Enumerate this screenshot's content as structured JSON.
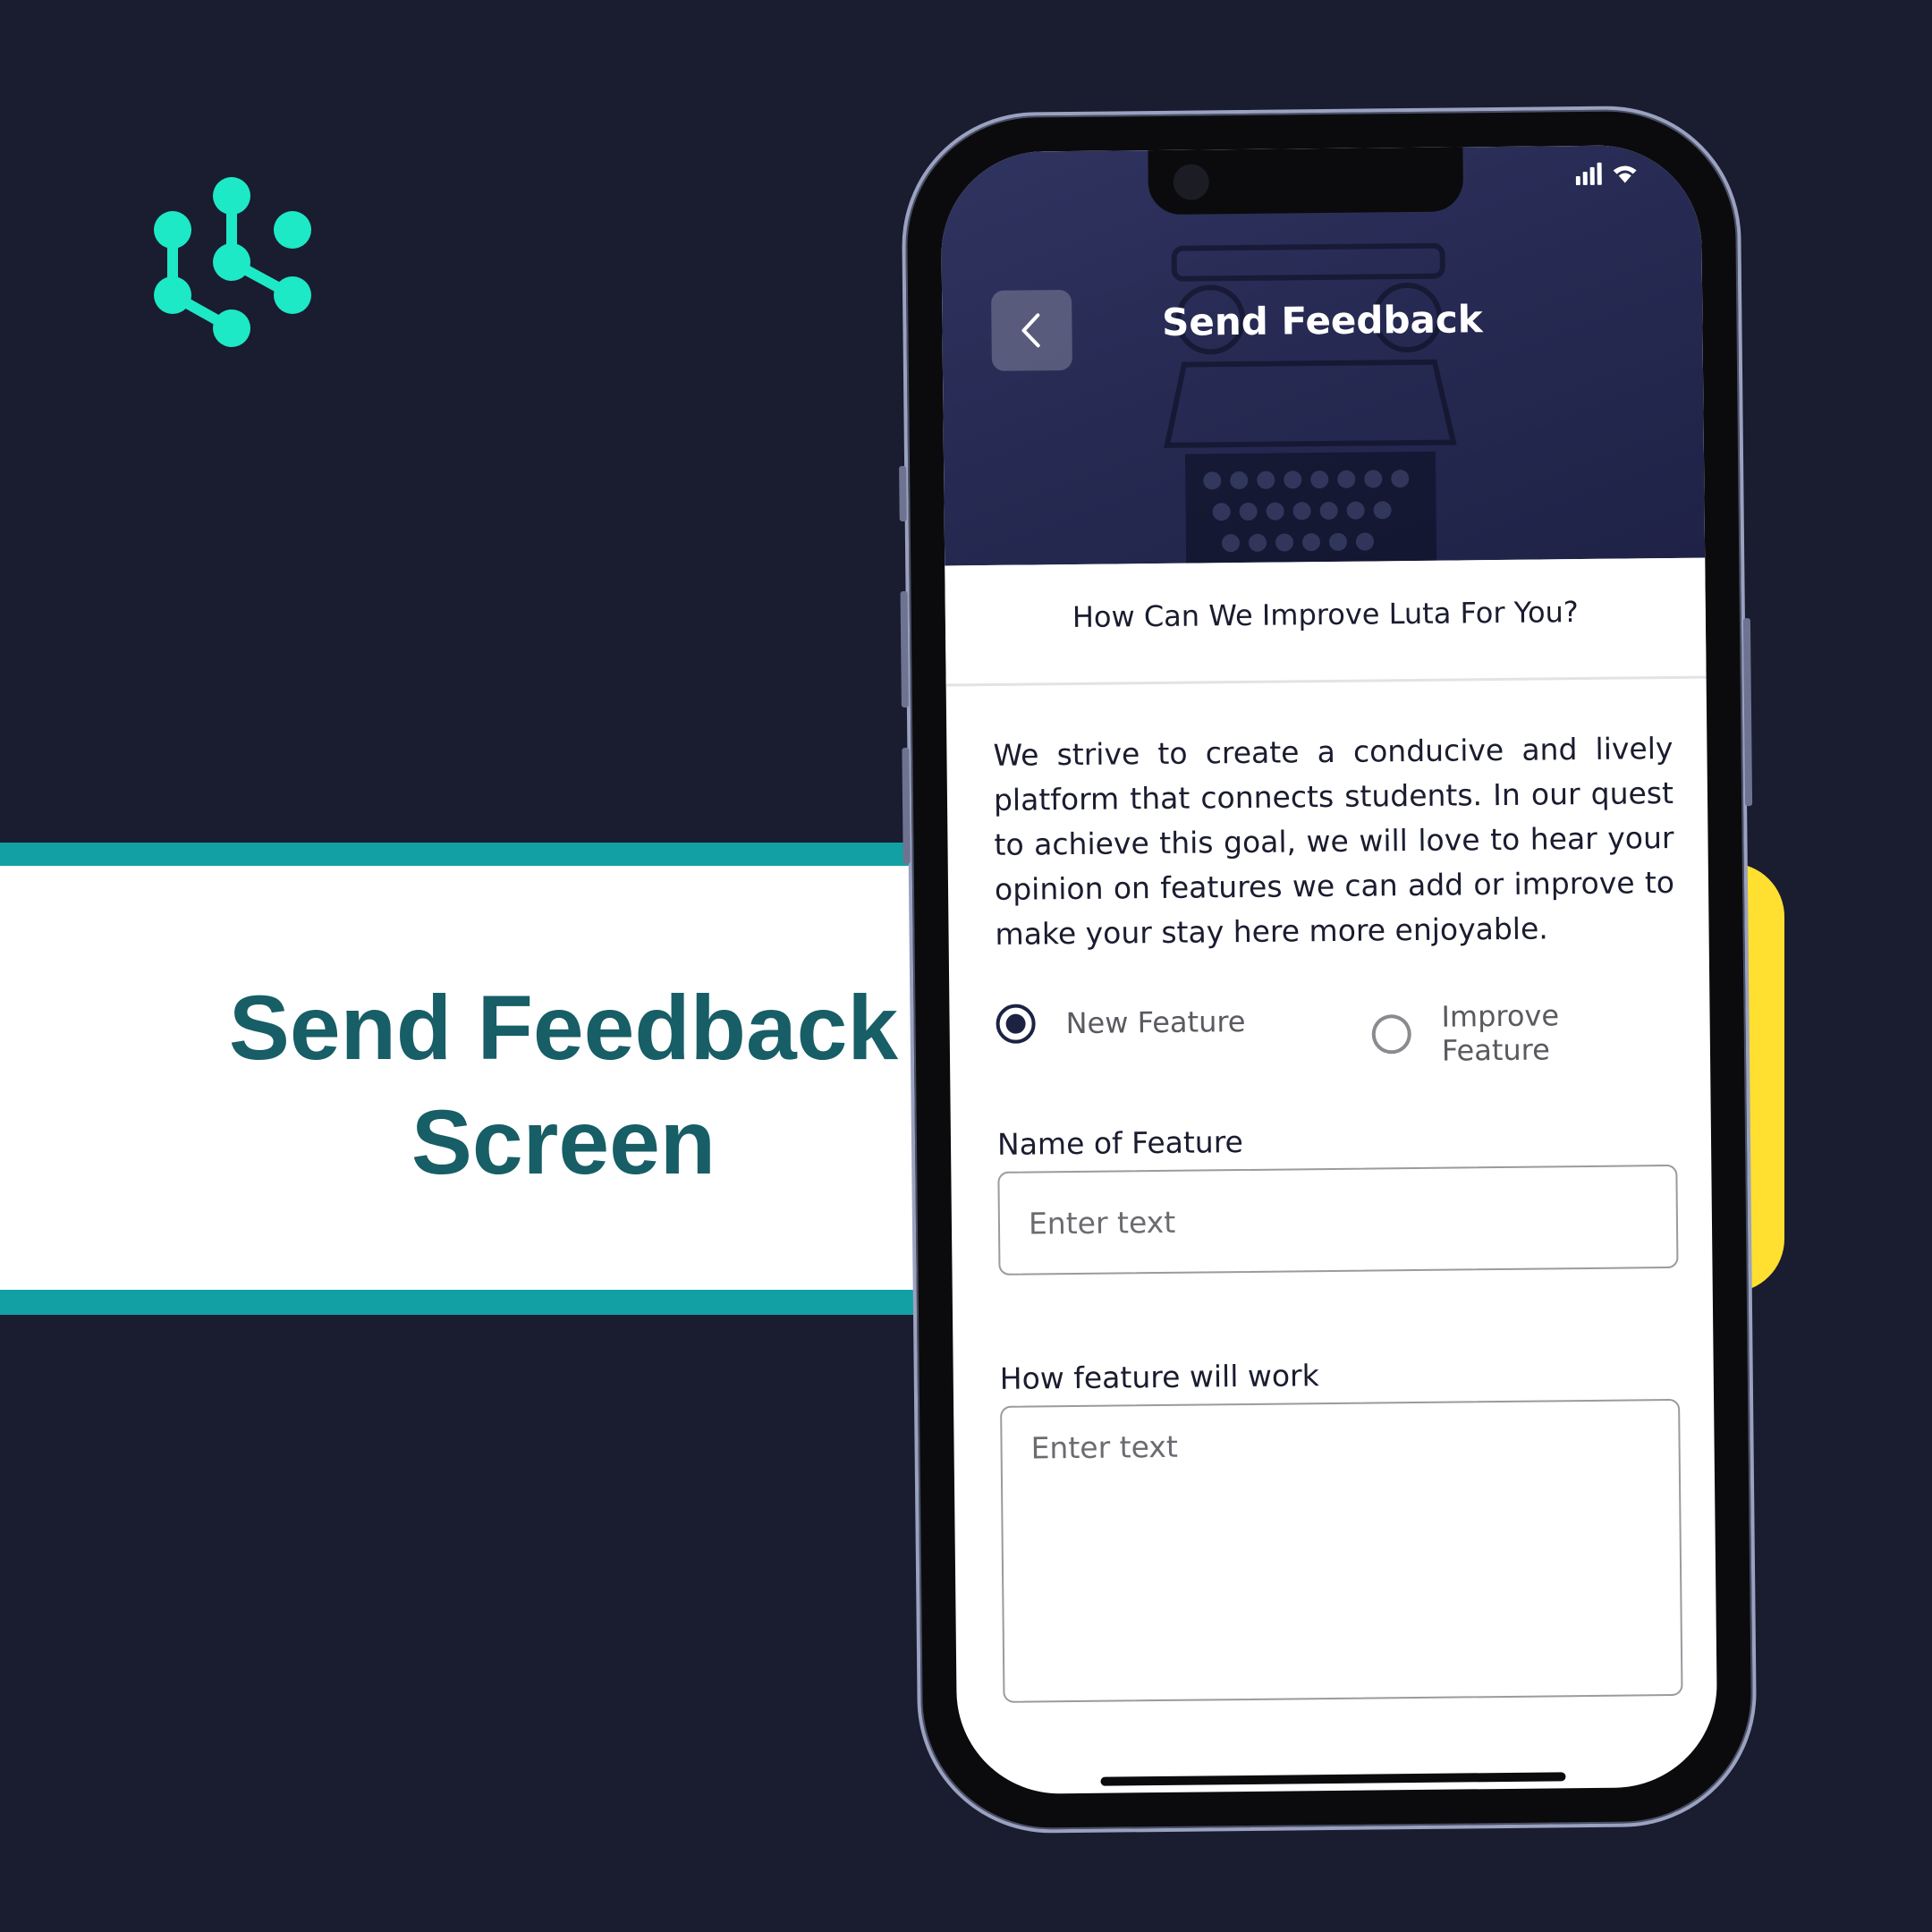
{
  "brand": {
    "accent": "#1de9c6",
    "banner_title": "Send Feedback Screen"
  },
  "phone": {
    "status": {
      "time": "",
      "icons": [
        "signal-icon",
        "wifi-icon"
      ]
    },
    "header": {
      "title": "Send Feedback",
      "back_icon": "chevron-left-icon"
    },
    "question": "How Can We Improve Luta For You?",
    "intro": "We strive to create a conducive and lively platform that connects students. In our quest to achieve this goal, we will love to hear your opinion on features we can add or improve to make your stay here more enjoyable.",
    "options": [
      {
        "label": "New Feature",
        "selected": true
      },
      {
        "label": "Improve Feature",
        "selected": false
      }
    ],
    "fields": {
      "name": {
        "label": "Name of Feature",
        "placeholder": "Enter text",
        "value": ""
      },
      "how": {
        "label": "How feature will work",
        "placeholder": "Enter text",
        "value": ""
      }
    }
  },
  "colors": {
    "background": "#1a1c2f",
    "banner_stripe": "#12a0a5",
    "banner_text": "#175e66",
    "yellow": "#ffdf30",
    "radio_selected": "#1c2342"
  }
}
